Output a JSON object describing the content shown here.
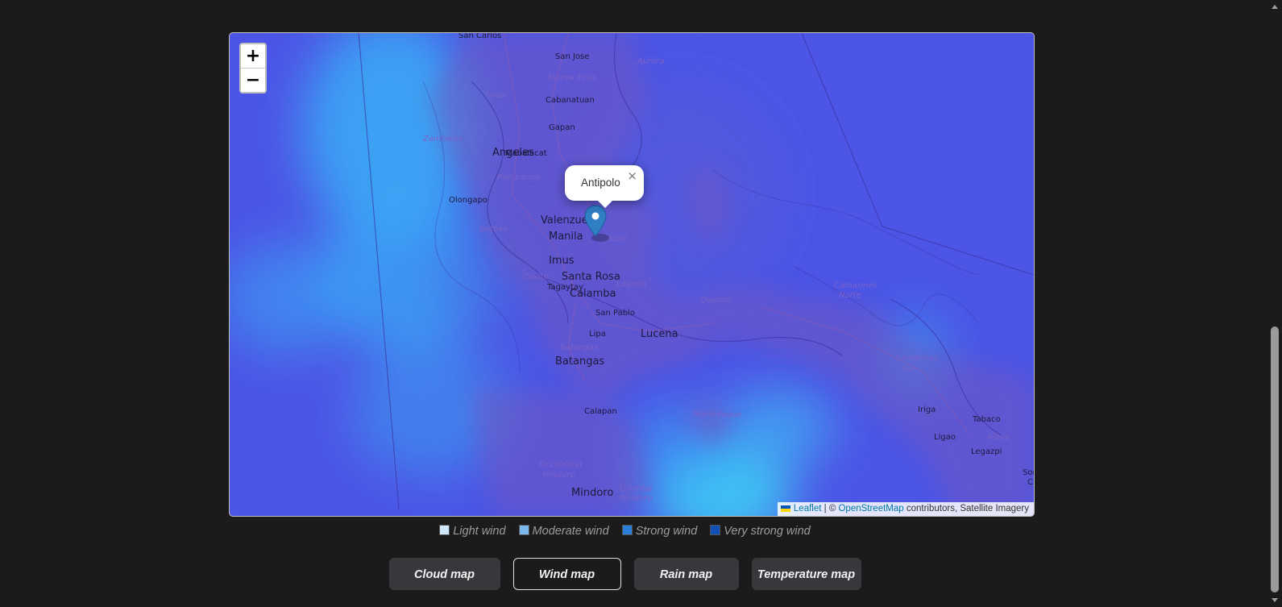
{
  "map": {
    "zoom_in": "+",
    "zoom_out": "−",
    "popup": {
      "label": "Antipolo",
      "close": "×"
    },
    "attribution": {
      "leaflet": "Leaflet",
      "separator": " | © ",
      "osm": "OpenStreetMap",
      "suffix": " contributors, Satellite Imagery"
    },
    "places": [
      {
        "name": "San Carlos",
        "style": "town"
      },
      {
        "name": "San Jose",
        "style": "town"
      },
      {
        "name": "Aurora",
        "style": "province"
      },
      {
        "name": "Nueva Ecija",
        "style": "province"
      },
      {
        "name": "Tarlac",
        "style": "province"
      },
      {
        "name": "Cabanatuan",
        "style": "town"
      },
      {
        "name": "Gapan",
        "style": "town"
      },
      {
        "name": "Zambales",
        "style": "province"
      },
      {
        "name": "Mabalacat",
        "style": "town"
      },
      {
        "name": "Angeles",
        "style": "city"
      },
      {
        "name": "Pampanga",
        "style": "province"
      },
      {
        "name": "Olongapo",
        "style": "town"
      },
      {
        "name": "Valenzuela",
        "style": "city"
      },
      {
        "name": "Bataan",
        "style": "province"
      },
      {
        "name": "Manila",
        "style": "city"
      },
      {
        "name": "Rizal",
        "style": "province"
      },
      {
        "name": "Imus",
        "style": "city"
      },
      {
        "name": "Cavite",
        "style": "province"
      },
      {
        "name": "Santa Rosa",
        "style": "city"
      },
      {
        "name": "Laguna",
        "style": "province"
      },
      {
        "name": "Calamba",
        "style": "city"
      },
      {
        "name": "Tagaytay",
        "style": "town"
      },
      {
        "name": "San Pablo",
        "style": "town"
      },
      {
        "name": "Quezon",
        "style": "province"
      },
      {
        "name": "Lipa",
        "style": "town"
      },
      {
        "name": "Lucena",
        "style": "city"
      },
      {
        "name": "Batangas",
        "style": "province"
      },
      {
        "name": "Batangas",
        "style": "city"
      },
      {
        "name": "Camarines",
        "style": "province"
      },
      {
        "name": "Norte",
        "style": "province"
      },
      {
        "name": "Camarines",
        "style": "province"
      },
      {
        "name": "Sur",
        "style": "province"
      },
      {
        "name": "Calapan",
        "style": "town"
      },
      {
        "name": "Marinduque",
        "style": "province"
      },
      {
        "name": "Iriga",
        "style": "town"
      },
      {
        "name": "Tabaco",
        "style": "town"
      },
      {
        "name": "Ligao",
        "style": "town"
      },
      {
        "name": "Albay",
        "style": "province"
      },
      {
        "name": "Legazpi",
        "style": "town"
      },
      {
        "name": "Occidental",
        "style": "province"
      },
      {
        "name": "Mindoro",
        "style": "province"
      },
      {
        "name": "Mindoro",
        "style": "city"
      },
      {
        "name": "Oriental",
        "style": "province"
      },
      {
        "name": "Mindoro",
        "style": "province"
      },
      {
        "name": "Sorsogon",
        "style": "town"
      },
      {
        "name": "City",
        "style": "town"
      }
    ]
  },
  "legend": [
    {
      "label": "Light wind",
      "color": "#cfe8fb"
    },
    {
      "label": "Moderate wind",
      "color": "#7ab8ee"
    },
    {
      "label": "Strong wind",
      "color": "#2b7fd9"
    },
    {
      "label": "Very strong wind",
      "color": "#1050b8"
    }
  ],
  "buttons": [
    {
      "label": "Cloud map",
      "active": false
    },
    {
      "label": "Wind map",
      "active": true
    },
    {
      "label": "Rain map",
      "active": false
    },
    {
      "label": "Temperature map",
      "active": false
    }
  ],
  "colors": {
    "page_bg": "#1b1b1b",
    "wind_base": "#4c55e6",
    "wind_light": "#3aa8f5",
    "land": "#7059c0",
    "marker": "#2f7fc4"
  }
}
